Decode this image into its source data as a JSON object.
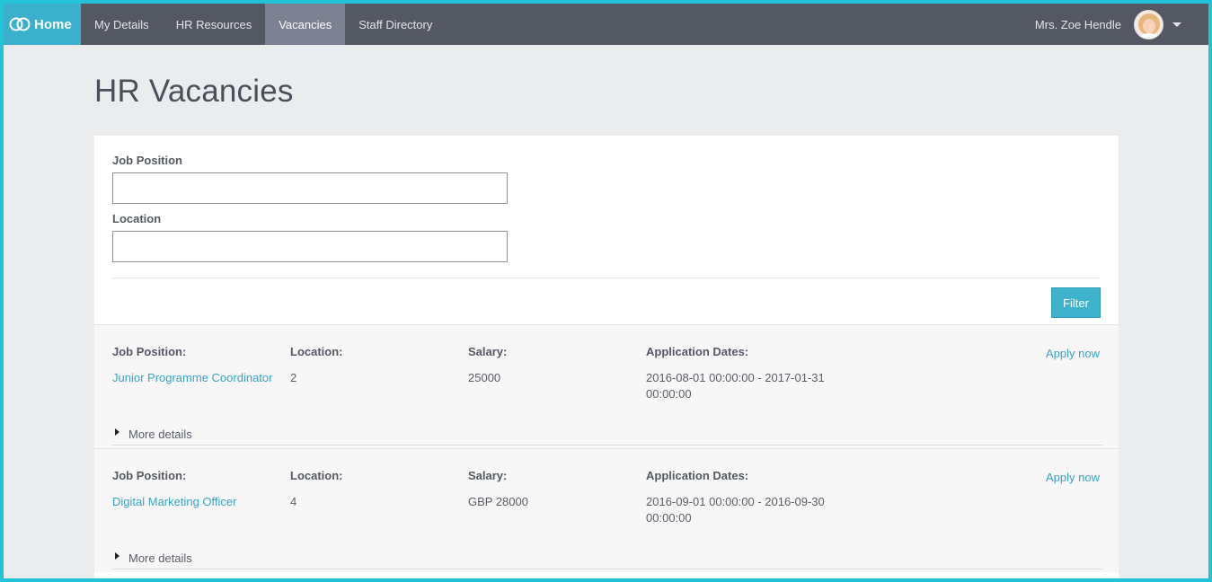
{
  "nav": {
    "home_label": "Home",
    "items": [
      {
        "label": "My Details"
      },
      {
        "label": "HR Resources"
      },
      {
        "label": "Vacancies",
        "active": true
      },
      {
        "label": "Staff Directory"
      }
    ],
    "user_name": "Mrs. Zoe Hendle"
  },
  "page": {
    "title": "HR Vacancies"
  },
  "filter": {
    "job_position_label": "Job Position",
    "job_position_value": "",
    "location_label": "Location",
    "location_value": "",
    "button_label": "Filter"
  },
  "vacancies": [
    {
      "position_header": "Job Position:",
      "position": "Junior Programme Coordinator",
      "location_header": "Location:",
      "location": "2",
      "salary_header": "Salary:",
      "salary": "25000",
      "dates_header": "Application Dates:",
      "dates": "2016-08-01 00:00:00 - 2017-01-31 00:00:00",
      "apply_label": "Apply now",
      "more_label": "More details"
    },
    {
      "position_header": "Job Position:",
      "position": "Digital Marketing Officer",
      "location_header": "Location:",
      "location": "4",
      "salary_header": "Salary:",
      "salary": "GBP 28000",
      "dates_header": "Application Dates:",
      "dates": "2016-09-01 00:00:00 - 2016-09-30 00:00:00",
      "apply_label": "Apply now",
      "more_label": "More details"
    }
  ],
  "colors": {
    "accent": "#3ab0cc",
    "nav_bg": "#545863",
    "nav_active": "#7c8192",
    "link": "#3aa3c4",
    "frame": "#22c3d6"
  }
}
